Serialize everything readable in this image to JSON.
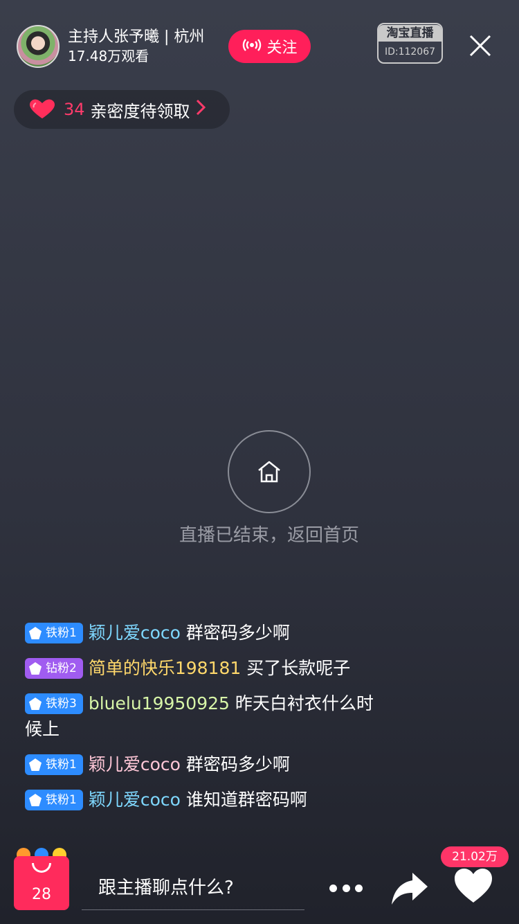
{
  "header": {
    "host_name": "主持人张予曦 | 杭州",
    "viewers": "17.48万观看",
    "follow_label": "关注",
    "platform_logo": "淘宝直播",
    "room_id": "ID:112067"
  },
  "intimacy": {
    "count": "34",
    "label": "亲密度待领取"
  },
  "status": {
    "ended_text": "直播已结束，返回首页"
  },
  "comments": [
    {
      "badge": "铁粉1",
      "user": "颖儿爱coco",
      "message": "群密码多少啊"
    },
    {
      "badge": "钻粉2",
      "user": "简单的快乐198181",
      "message": "买了长款呢子"
    },
    {
      "badge": "铁粉3",
      "user": "bluelu19950925",
      "message": "昨天白衬衣什么时候上"
    },
    {
      "badge": "铁粉1",
      "user": "颖儿爱coco",
      "message": "群密码多少啊"
    },
    {
      "badge": "铁粉1",
      "user": "颖儿爱coco",
      "message": "谁知道群密码啊"
    }
  ],
  "bottom": {
    "cart_count": "28",
    "chat_placeholder": "跟主播聊点什么?",
    "like_count": "21.02万"
  },
  "colors": {
    "accent": "#ff1f5a",
    "background": "#353946",
    "iron_badge": "#2d8cff",
    "diamond_badge": "#a05cf0"
  },
  "icons": [
    "broadcast-icon",
    "close-icon",
    "heart-icon",
    "chevron-right-icon",
    "home-icon",
    "shopping-bag-icon",
    "more-icon",
    "share-icon",
    "like-icon"
  ]
}
